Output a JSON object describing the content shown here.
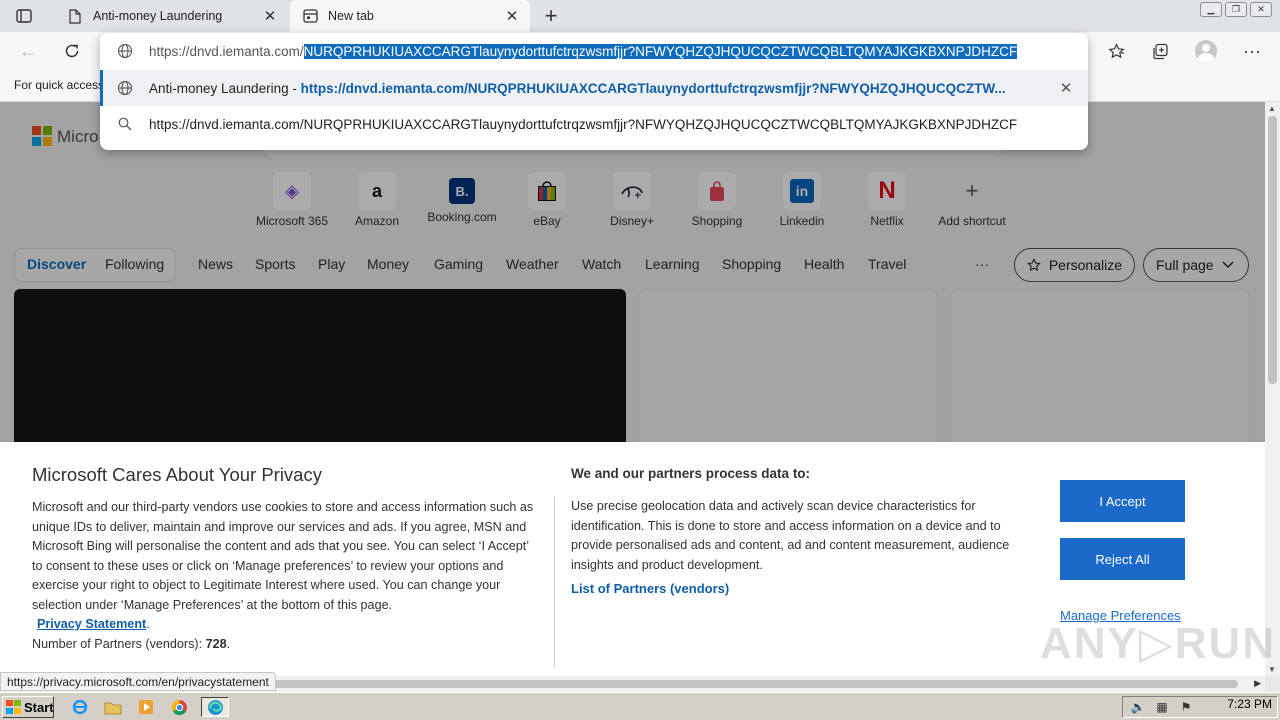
{
  "tabs": [
    {
      "title": "Anti-money Laundering",
      "active": false
    },
    {
      "title": "New tab",
      "active": true
    }
  ],
  "address": {
    "host": "https://dnvd.iemanta.com/",
    "selected_path": "NURQPRHUKIUAXCCARGTlauynydorttufctrqzwsmfjjr?NFWYQHZQJHQUCQCZTWCQBLTQMYAJKGKBXNPJDHZCF"
  },
  "suggestions": [
    {
      "title": "Anti-money Laundering",
      "separator": " - ",
      "url": "https://dnvd.iemanta.com/NURQPRHUKIUAXCCARGTlauynydorttufctrqzwsmfjjr?NFWYQHZQJHQUCQCZTW..."
    },
    {
      "text": "https://dnvd.iemanta.com/NURQPRHUKIUAXCCARGTlauynydorttufctrqzwsmfjjr?NFWYQHZQJHQUCQCZTWCQBLTQMYAJKGKBXNPJDHZCF"
    }
  ],
  "favbar": {
    "text": "For quick access"
  },
  "newtab": {
    "logo_text": "Micro",
    "shortcuts": [
      {
        "label": "Microsoft 365",
        "glyph": "◈",
        "color": "#7b4fd6"
      },
      {
        "label": "Amazon",
        "glyph": "a",
        "color": "#111111"
      },
      {
        "label": "Booking.com",
        "glyph": "B.",
        "color": "#ffffff"
      },
      {
        "label": "eBay",
        "glyph": "▣",
        "color": "#e53238"
      },
      {
        "label": "Disney+",
        "glyph": "⊃",
        "color": "#1a1a2e"
      },
      {
        "label": "Shopping",
        "glyph": "■",
        "color": "#e84a5f"
      },
      {
        "label": "Linkedin",
        "glyph": "in",
        "color": "#ffffff"
      },
      {
        "label": "Netflix",
        "glyph": "N",
        "color": "#e50914"
      },
      {
        "label": "Add shortcut",
        "glyph": "+",
        "color": "#555555"
      }
    ],
    "feed_nav": {
      "discover": "Discover",
      "following": "Following",
      "items": [
        "News",
        "Sports",
        "Play",
        "Money",
        "Gaming",
        "Weather",
        "Watch",
        "Learning",
        "Shopping",
        "Health",
        "Travel"
      ],
      "more": "···",
      "personalize": "Personalize",
      "full_page": "Full page"
    }
  },
  "consent": {
    "title": "Microsoft Cares About Your Privacy",
    "body": "Microsoft and our third-party vendors use cookies to store and access information such as unique IDs to deliver, maintain and improve our services and ads. If you agree, MSN and Microsoft Bing will personalise the content and ads that you see. You can select ‘I Accept’ to consent to these uses or click on ‘Manage preferences’ to review your options and exercise your right to object to Legitimate Interest where used.  You can change your selection under ‘Manage Preferences’ at the bottom of this page.",
    "privacy_link": "Privacy Statement",
    "period": ".",
    "partners_label": "Number of Partners (vendors): ",
    "partners_count": "728",
    "purpose_title": "We and our partners process data to:",
    "purpose_body": "Use precise geolocation data and actively scan device characteristics for identification. This is done to store and access information on a device and to provide personalised ads and content, ad and content measurement, audience insights and product development.",
    "partners_link": "List of Partners (vendors)",
    "accept": "I Accept",
    "reject": "Reject All",
    "manage": "Manage Preferences"
  },
  "watermark": "ANY▷RUN",
  "status_url": "https://privacy.microsoft.com/en/privacystatement",
  "taskbar": {
    "start": "Start",
    "clock": "7:23 PM"
  }
}
